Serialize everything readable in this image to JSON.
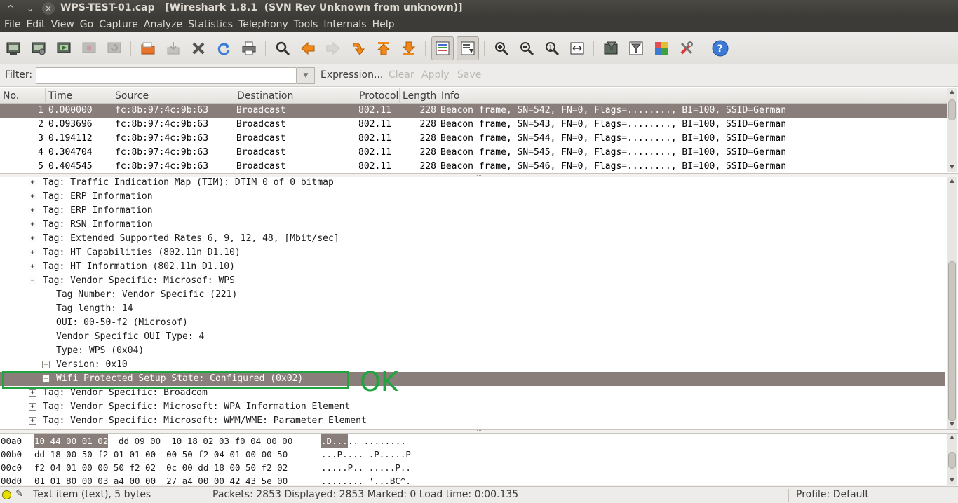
{
  "window": {
    "title": "WPS-TEST-01.cap   [Wireshark 1.8.1  (SVN Rev Unknown from unknown)]"
  },
  "menu": [
    "File",
    "Edit",
    "View",
    "Go",
    "Capture",
    "Analyze",
    "Statistics",
    "Telephony",
    "Tools",
    "Internals",
    "Help"
  ],
  "toolbar": {
    "icons": [
      "interface-list-icon",
      "capture-options-icon",
      "start-capture-icon",
      "stop-capture-icon",
      "restart-capture-icon",
      "open-file-icon",
      "save-file-icon",
      "close-file-icon",
      "reload-icon",
      "print-icon",
      "find-packet-icon",
      "go-back-icon",
      "go-forward-icon",
      "go-to-packet-icon",
      "go-first-icon",
      "go-last-icon",
      "colorize-icon",
      "auto-scroll-icon",
      "zoom-in-icon",
      "zoom-out-icon",
      "normal-size-icon",
      "resize-columns-icon",
      "capture-filters-icon",
      "display-filters-icon",
      "coloring-rules-icon",
      "preferences-icon",
      "help-icon"
    ]
  },
  "filter": {
    "label": "Filter:",
    "value": "",
    "expression": "Expression...",
    "clear": "Clear",
    "apply": "Apply",
    "save": "Save"
  },
  "packet_list": {
    "columns": [
      "No.",
      "Time",
      "Source",
      "Destination",
      "Protocol",
      "Length",
      "Info"
    ],
    "rows": [
      {
        "no": "1",
        "time": "0.000000",
        "source": "fc:8b:97:4c:9b:63",
        "destination": "Broadcast",
        "protocol": "802.11",
        "length": "228",
        "info": "Beacon frame, SN=542, FN=0, Flags=........, BI=100, SSID=German"
      },
      {
        "no": "2",
        "time": "0.093696",
        "source": "fc:8b:97:4c:9b:63",
        "destination": "Broadcast",
        "protocol": "802.11",
        "length": "228",
        "info": "Beacon frame, SN=543, FN=0, Flags=........, BI=100, SSID=German"
      },
      {
        "no": "3",
        "time": "0.194112",
        "source": "fc:8b:97:4c:9b:63",
        "destination": "Broadcast",
        "protocol": "802.11",
        "length": "228",
        "info": "Beacon frame, SN=544, FN=0, Flags=........, BI=100, SSID=German"
      },
      {
        "no": "4",
        "time": "0.304704",
        "source": "fc:8b:97:4c:9b:63",
        "destination": "Broadcast",
        "protocol": "802.11",
        "length": "228",
        "info": "Beacon frame, SN=545, FN=0, Flags=........, BI=100, SSID=German"
      },
      {
        "no": "5",
        "time": "0.404545",
        "source": "fc:8b:97:4c:9b:63",
        "destination": "Broadcast",
        "protocol": "802.11",
        "length": "228",
        "info": "Beacon frame, SN=546, FN=0, Flags=........, BI=100, SSID=German"
      }
    ]
  },
  "details": {
    "rows": [
      {
        "expander": "+",
        "level": 0,
        "text": "Tag: Traffic Indication Map (TIM): DTIM 0 of 0 bitmap"
      },
      {
        "expander": "+",
        "level": 0,
        "text": "Tag: ERP Information"
      },
      {
        "expander": "+",
        "level": 0,
        "text": "Tag: ERP Information"
      },
      {
        "expander": "+",
        "level": 0,
        "text": "Tag: RSN Information"
      },
      {
        "expander": "+",
        "level": 0,
        "text": "Tag: Extended Supported Rates 6, 9, 12, 48, [Mbit/sec]"
      },
      {
        "expander": "+",
        "level": 0,
        "text": "Tag: HT Capabilities (802.11n D1.10)"
      },
      {
        "expander": "+",
        "level": 0,
        "text": "Tag: HT Information (802.11n D1.10)"
      },
      {
        "expander": "−",
        "level": 0,
        "text": "Tag: Vendor Specific: Microsof: WPS"
      },
      {
        "expander": "",
        "level": 1,
        "text": "Tag Number: Vendor Specific (221)"
      },
      {
        "expander": "",
        "level": 1,
        "text": "Tag length: 14"
      },
      {
        "expander": "",
        "level": 1,
        "text": "OUI: 00-50-f2 (Microsof)"
      },
      {
        "expander": "",
        "level": 1,
        "text": "Vendor Specific OUI Type: 4"
      },
      {
        "expander": "",
        "level": 1,
        "text": "Type: WPS (0x04)"
      },
      {
        "expander": "+",
        "level": 1,
        "text": "Version: 0x10"
      },
      {
        "expander": "+",
        "level": 1,
        "text": "Wifi Protected Setup State: Configured (0x02)"
      },
      {
        "expander": "+",
        "level": 0,
        "text": "Tag: Vendor Specific: Broadcom"
      },
      {
        "expander": "+",
        "level": 0,
        "text": "Tag: Vendor Specific: Microsoft: WPA Information Element"
      },
      {
        "expander": "+",
        "level": 0,
        "text": "Tag: Vendor Specific: Microsoft: WMM/WME: Parameter Element"
      }
    ],
    "annotation": "OK"
  },
  "hex": {
    "rows": [
      {
        "offset": "00a0",
        "bytes_sel": "10 44 00 01 02",
        "bytes": "dd 09 00  10 18 02 03 f0 04 00 00",
        "ascii_sel": ".D...",
        "ascii": ".. ........"
      },
      {
        "offset": "00b0",
        "bytes_sel": "",
        "bytes": "dd 18 00 50 f2 01 01 00  00 50 f2 04 01 00 00 50",
        "ascii_sel": "",
        "ascii": "...P.... .P.....P"
      },
      {
        "offset": "00c0",
        "bytes_sel": "",
        "bytes": "f2 04 01 00 00 50 f2 02  0c 00 dd 18 00 50 f2 02",
        "ascii_sel": "",
        "ascii": ".....P.. .....P.."
      },
      {
        "offset": "00d0",
        "bytes_sel": "",
        "bytes": "01 01 80 00 03 a4 00 00  27 a4 00 00 42 43 5e 00",
        "ascii_sel": "",
        "ascii": "........ '...BC^."
      }
    ]
  },
  "status": {
    "item": "Text item (text), 5 bytes",
    "packets": "Packets: 2853 Displayed: 2853 Marked: 0 Load time: 0:00.135",
    "profile": "Profile: Default"
  },
  "colors": {
    "selection": "#8a7e7a",
    "annotation": "#21a340",
    "titlebar": "#3c3b37"
  }
}
